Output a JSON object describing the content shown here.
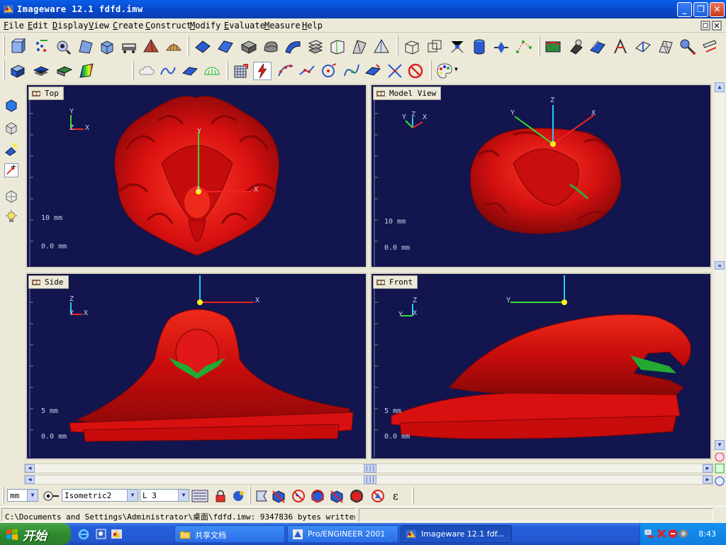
{
  "window": {
    "title": "Imageware 12.1    fdfd.imw"
  },
  "menu": [
    "File",
    "Edit",
    "Display",
    "View",
    "Create",
    "Construct",
    "Modify",
    "Evaluate",
    "Measure",
    "Help"
  ],
  "viewports": {
    "top": {
      "label": "Top",
      "scale_top": "10 mm",
      "scale_bottom": "0.0 mm",
      "axis_y": "Y",
      "axis_x": "X",
      "axis_z": "Z",
      "triad_y": "Y",
      "triad_x": "X",
      "triad_z": "Z"
    },
    "model": {
      "label": "Model View",
      "scale_top": "10 mm",
      "scale_bottom": "0.0 mm",
      "triad_y": "Y",
      "triad_z": "Z",
      "triad_x": "X",
      "axis_y": "Y",
      "axis_z": "Z",
      "axis_x": "X"
    },
    "side": {
      "label": "Side",
      "scale_top": "5 mm",
      "scale_bottom": "0.0 mm",
      "triad_z": "Z",
      "triad_y": "Y",
      "triad_x": "X",
      "axis_x": "X"
    },
    "front": {
      "label": "Front",
      "scale_top": "5 mm",
      "scale_bottom": "0.0 mm",
      "triad_z": "Z",
      "triad_y": "Y",
      "triad_x": "X",
      "axis_y": "Y"
    }
  },
  "bottom_toolbar": {
    "units": "mm",
    "view_mode": "Isometric2",
    "layer": "L 3",
    "epsilon": "ε"
  },
  "status": {
    "message": "C:\\Documents and Settings\\Administrator\\桌面\\fdfd.imw: 9347836 bytes written"
  },
  "taskbar": {
    "start_label": "开始",
    "tasks": [
      {
        "label": "共享文档"
      },
      {
        "label": "Pro/ENGINEER 2001"
      },
      {
        "label": "Imageware 12.1  fdf..."
      }
    ],
    "clock": "8:43"
  },
  "colors": {
    "viewport_bg": "#12154e",
    "model_red": "#d81010",
    "axis_green": "#33dd33",
    "axis_red": "#ee2222",
    "axis_cyan": "#22ccee"
  }
}
